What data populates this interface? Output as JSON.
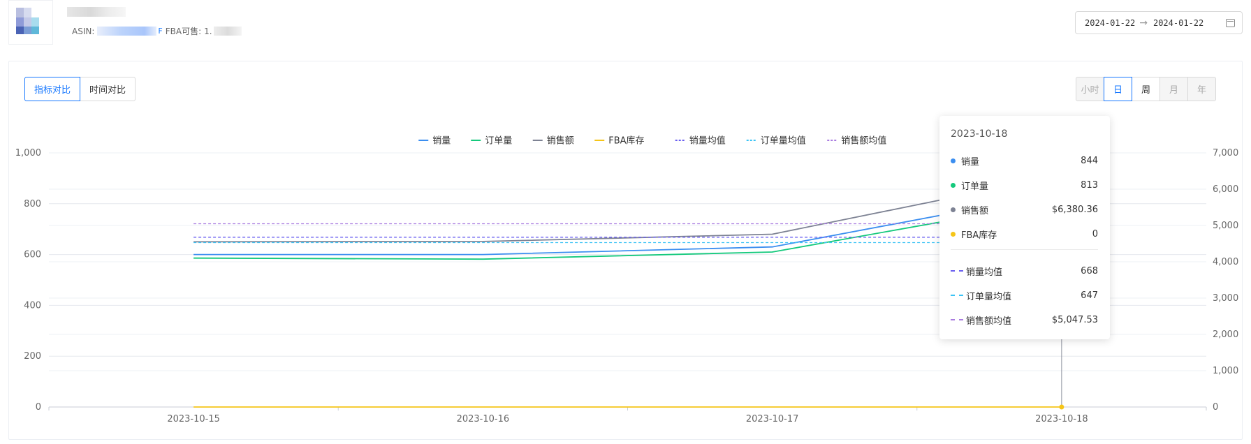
{
  "header": {
    "asin_label": "ASIN:",
    "asin_tail": "F",
    "fba_label": "FBA可售:",
    "fba_value_visible": "1."
  },
  "date_range": {
    "start": "2024-01-22",
    "end": "2024-01-22",
    "separator_icon": "arrow-right-icon",
    "calendar_icon": "calendar-icon"
  },
  "compare_tabs": [
    {
      "label": "指标对比",
      "active": true
    },
    {
      "label": "时间对比",
      "active": false
    }
  ],
  "granularity_tabs": [
    {
      "label": "小时",
      "active": false,
      "disabled": true
    },
    {
      "label": "日",
      "active": true,
      "disabled": false
    },
    {
      "label": "周",
      "active": false,
      "disabled": false
    },
    {
      "label": "月",
      "active": false,
      "disabled": true
    },
    {
      "label": "年",
      "active": false,
      "disabled": true
    }
  ],
  "colors": {
    "sales": "#3b8ef0",
    "orders": "#14c97c",
    "revenue": "#7d8293",
    "fba": "#f5c518",
    "sales_avg": "#6a5ff0",
    "orders_avg": "#3bc3f5",
    "revenue_avg": "#a97be0",
    "primary": "#1677ff"
  },
  "chart_data": {
    "type": "line",
    "x": [
      "2023-10-15",
      "2023-10-16",
      "2023-10-17",
      "2023-10-18"
    ],
    "ylim_left": [
      0,
      1000
    ],
    "ylim_right": [
      0,
      7000
    ],
    "yticks_left": [
      "0",
      "200",
      "400",
      "600",
      "800",
      "1,000"
    ],
    "yticks_right": [
      "0",
      "1,000",
      "2,000",
      "3,000",
      "4,000",
      "5,000",
      "6,000",
      "7,000"
    ],
    "legend_position": "top-center",
    "grid": true,
    "series": [
      {
        "key": "sales",
        "name": "销量",
        "axis": "left",
        "style": "solid",
        "values": [
          600,
          600,
          630,
          844
        ]
      },
      {
        "key": "orders",
        "name": "订单量",
        "axis": "left",
        "style": "solid",
        "values": [
          586,
          582,
          610,
          813
        ]
      },
      {
        "key": "revenue",
        "name": "销售额",
        "axis": "right",
        "style": "solid",
        "values": [
          4550,
          4560,
          4760,
          6380.36
        ]
      },
      {
        "key": "fba",
        "name": "FBA库存",
        "axis": "left",
        "style": "solid",
        "values": [
          0,
          0,
          0,
          0
        ]
      },
      {
        "key": "sales_avg",
        "name": "销量均值",
        "axis": "left",
        "style": "dashed",
        "values": [
          668,
          668,
          668,
          668
        ]
      },
      {
        "key": "orders_avg",
        "name": "订单量均值",
        "axis": "left",
        "style": "dashed",
        "values": [
          647,
          647,
          647,
          647
        ]
      },
      {
        "key": "revenue_avg",
        "name": "销售额均值",
        "axis": "right",
        "style": "dashed",
        "values": [
          5047.53,
          5047.53,
          5047.53,
          5047.53
        ]
      }
    ]
  },
  "tooltip": {
    "date": "2023-10-18",
    "rows": [
      {
        "name": "销量",
        "value": "844",
        "color_key": "sales",
        "marker": "dot"
      },
      {
        "name": "订单量",
        "value": "813",
        "color_key": "orders",
        "marker": "dot"
      },
      {
        "name": "销售额",
        "value": "$6,380.36",
        "color_key": "revenue",
        "marker": "dot"
      },
      {
        "name": "FBA库存",
        "value": "0",
        "color_key": "fba",
        "marker": "dot"
      }
    ],
    "avg_rows": [
      {
        "name": "销量均值",
        "value": "668",
        "color_key": "sales_avg",
        "marker": "dash"
      },
      {
        "name": "订单量均值",
        "value": "647",
        "color_key": "orders_avg",
        "marker": "dash"
      },
      {
        "name": "销售额均值",
        "value": "$5,047.53",
        "color_key": "revenue_avg",
        "marker": "dash"
      }
    ]
  }
}
